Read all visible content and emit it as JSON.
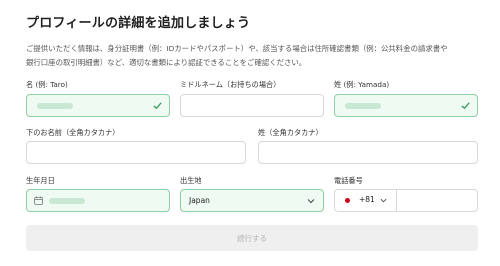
{
  "title": "プロフィールの詳細を追加しましょう",
  "description_line1": "ご提供いただく情報は、身分証明書（例：IDカードやパスポート）や、該当する場合は住所確認書類（例：公共料金の請求書や",
  "description_line2": "銀行口座の取引明細書）など、適切な書類により認証できることをご確認ください。",
  "fields": {
    "last_name_label": "名 (例: Taro)",
    "middle_name_label": "ミドルネーム（お持ちの場合）",
    "first_name_label": "姓 (例: Yamada)",
    "last_name_kana_label": "下のお名前（全角カタカナ）",
    "first_name_kana_label": "姓（全角カタカナ）",
    "dob_label": "生年月日",
    "birthplace_label": "出生地",
    "birthplace_value": "Japan",
    "phone_label": "電話番号",
    "phone_code": "+81"
  },
  "submit_label": "続行する",
  "colors": {
    "valid_bg": "#eefaf2",
    "valid_border": "#8fcfa6",
    "check": "#2d9b55",
    "flag": "#d0021b"
  }
}
